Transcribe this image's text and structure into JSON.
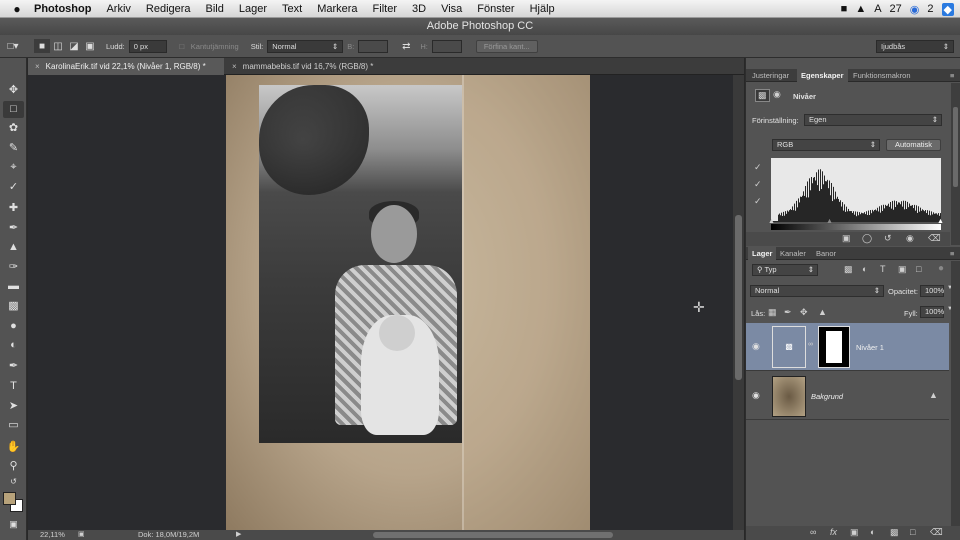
{
  "menubar": {
    "app": "Photoshop",
    "items": [
      "Arkiv",
      "Redigera",
      "Bild",
      "Lager",
      "Text",
      "Markera",
      "Filter",
      "3D",
      "Visa",
      "Fönster",
      "Hjälp"
    ],
    "right": {
      "adobe_count": "27",
      "cc_count": "2"
    }
  },
  "window": {
    "title": "Adobe Photoshop CC"
  },
  "options": {
    "feather_label": "Ludd:",
    "feather_value": "0 px",
    "antialias_label": "Kantutjämning",
    "style_label": "Stil:",
    "style_value": "Normal",
    "width_label": "B:",
    "height_label": "H:",
    "refine_label": "Förfina kant...",
    "workspace": "Ijudbås"
  },
  "tabs": [
    {
      "label": "KarolinaErik.tif vid 22,1% (Nivåer 1, RGB/8) *",
      "active": true
    },
    {
      "label": "mammabebis.tif vid 16,7% (RGB/8) *",
      "active": false
    }
  ],
  "status": {
    "zoom": "22,11%",
    "doc": "Dok: 18,0M/19,2M"
  },
  "properties": {
    "tabs": [
      "Justeringar",
      "Egenskaper",
      "Funktionsmakron"
    ],
    "title": "Nivåer",
    "preset_label": "Förinställning:",
    "preset_value": "Egen",
    "channel": "RGB",
    "auto_label": "Automatisk"
  },
  "layers": {
    "tabs": [
      "Lager",
      "Kanaler",
      "Banor"
    ],
    "filter": "Typ",
    "blend_mode": "Normal",
    "opacity_label": "Opacitet:",
    "opacity_value": "100%",
    "lock_label": "Lås:",
    "fill_label": "Fyll:",
    "fill_value": "100%",
    "items": [
      {
        "name": "Nivåer 1",
        "selected": true
      },
      {
        "name": "Bakgrund",
        "selected": false
      }
    ]
  },
  "colors": {
    "foreground": "#b7a27a",
    "background": "#ffffff",
    "selected_layer": "#7b8aa4"
  }
}
